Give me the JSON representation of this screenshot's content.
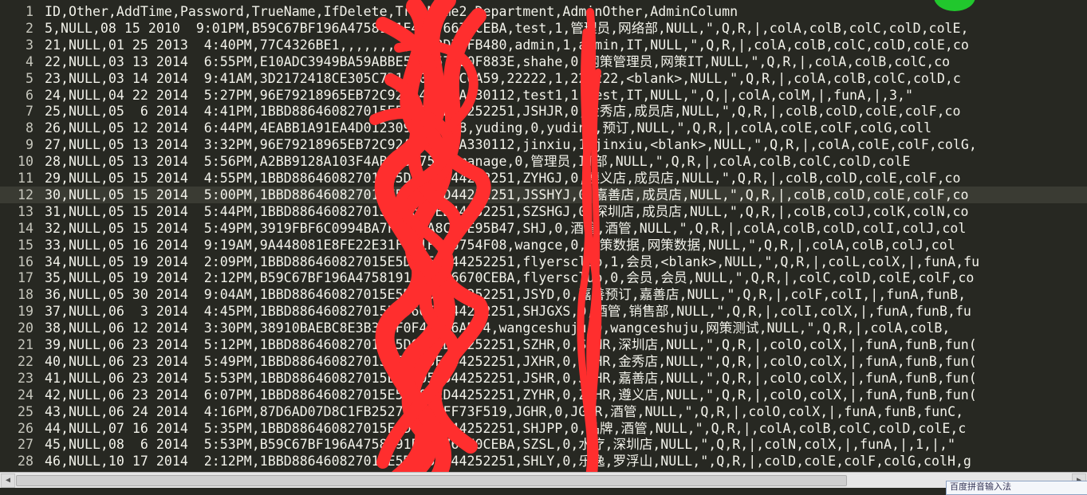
{
  "editor": {
    "lines": [
      {
        "num": "1",
        "text": "ID,Other,AddTime,Password,TrueName,IfDelete,TrueName2,Department,AdminOther,AdminColumn"
      },
      {
        "num": "2",
        "text": "5,NULL,08 15 2010  9:01PM,B59C67BF196A4758191E42F76670CEBA,test,1,管理员,网络部,NULL,\",Q,R,|,colA,colB,colC,colD,colE,"
      },
      {
        "num": "3",
        "text": "21,NULL,01 25 2013  4:40PM,77C4326BE1,,,,,,,,,,CF3D7BFB480,admin,1,admin,IT,NULL,\",Q,R,|,colA,colB,colC,colD,colE,co"
      },
      {
        "num": "4",
        "text": "22,NULL,03 13 2014  6:55PM,E10ADC3949BA59ABBE56E057F20F883E,shahe,0,网策管理员,网策IT,NULL,\",Q,R,|,colA,colB,colC,co"
      },
      {
        "num": "5",
        "text": "23,NULL,03 14 2014  9:41AM,3D2172418CE305C7D16D05597C6A59,22222,1,222222,<blank>,NULL,\",Q,R,|,colA,colB,colC,colD,c"
      },
      {
        "num": "6",
        "text": "24,NULL,04 22 2014  5:27PM,96E79218965EB72C92A549DD5A330112,test1,1,test,IT,NULL,\",Q,|,colA,colM,|,funA,|,3,\""
      },
      {
        "num": "7",
        "text": "25,NULL,05  6 2014  4:41PM,1BBD886460827015E5D605ED44252251,JSHJR,0,金秀店,成员店,NULL,\",Q,R,|,colB,colD,colE,colF,co"
      },
      {
        "num": "8",
        "text": "26,NULL,05 12 2014  6:44PM,4EABB1A91EA4D0123093BC69E8,yuding,0,yuding,预订,NULL,\",Q,R,|,colA,colE,colF,colG,coll"
      },
      {
        "num": "9",
        "text": "27,NULL,05 13 2014  3:32PM,96E79218965EB72C92A549DD5A330112,jinxiu,1,jinxiu,<blank>,NULL,\",Q,R,|,colA,colE,colF,colG,"
      },
      {
        "num": "10",
        "text": "28,NULL,05 13 2014  5:56PM,A2BB9128A103F4ABE65B759A,manage,0,管理员,IT部,NULL,\",Q,R,|,colA,colB,colC,colD,colE"
      },
      {
        "num": "11",
        "text": "29,NULL,05 15 2014  4:55PM,1BBD886460827015E5D605ED44252251,ZYHGJ,0,遵义店,成员店,NULL,\",Q,R,|,colB,colD,colE,colF,co"
      },
      {
        "num": "12",
        "text": "30,NULL,05 15 2014  5:00PM,1BBD886460827015E5D605ED44252251,JSSHYJ,0,嘉善店,成员店,NULL,\",Q,R,|,colB,colD,colE,colF,co"
      },
      {
        "num": "13",
        "text": "31,NULL,05 15 2014  5:44PM,1BBD886460827015E5D605ED44252251,SZSHGJ,0,深圳店,成员店,NULL,\",Q,R,|,colB,colJ,colK,colN,co"
      },
      {
        "num": "14",
        "text": "32,NULL,05 15 2014  5:49PM,3919FBF6C0994BA7F5C8BA8C30E95B47,SHJ,0,酒管,酒管,NULL,\",Q,R,|,colA,colB,colD,colI,colJ,col"
      },
      {
        "num": "15",
        "text": "33,NULL,05 16 2014  9:19AM,9A448081E8FE22E31FDC1F326754F08,wangce,0,网策数据,网策数据,NULL,\",Q,R,|,colA,colB,colJ,col"
      },
      {
        "num": "16",
        "text": "34,NULL,05 19 2014  2:09PM,1BBD886460827015E5D605ED44252251,flyersclub,1,会员,<blank>,NULL,\",Q,R,|,colL,colX,|,funA,fu"
      },
      {
        "num": "17",
        "text": "35,NULL,05 19 2014  2:12PM,B59C67BF196A4758191E42F76670CEBA,flyersclub,0,会员,会员,NULL,\",Q,R,|,colC,colD,colE,colF,co"
      },
      {
        "num": "18",
        "text": "36,NULL,05 30 2014  9:04AM,1BBD886460827015E5D605ED44252251,JSYD,0,嘉善预订,嘉善店,NULL,\",Q,R,|,colF,colI,|,funA,funB,"
      },
      {
        "num": "19",
        "text": "37,NULL,06  3 2014  4:45PM,1BBD886460827015E5D605ED44252251,SHJGXS,0,酒管,销售部,NULL,\",Q,R,|,colI,colX,|,funA,funB,fu"
      },
      {
        "num": "20",
        "text": "38,NULL,06 12 2014  3:30PM,38910BAEBC8E3B3D0F0F4B8A6AB54,wangceshuju,0,wangceshuju,网策测试,NULL,\",Q,R,|,colA,colB,"
      },
      {
        "num": "21",
        "text": "39,NULL,06 23 2014  5:12PM,1BBD886460827015E5D605ED44252251,SZHR,0,SZHR,深圳店,NULL,\",Q,R,|,colO,colX,|,funA,funB,fun("
      },
      {
        "num": "22",
        "text": "40,NULL,06 23 2014  5:49PM,1BBD886460827015E5D605ED44252251,JXHR,0,JXHR,金秀店,NULL,\",Q,R,|,colO,colX,|,funA,funB,fun("
      },
      {
        "num": "23",
        "text": "41,NULL,06 23 2014  5:53PM,1BBD886460827015E5D605ED44252251,JSHR,0,JSHR,嘉善店,NULL,\",Q,R,|,colO,colX,|,funA,funB,fun("
      },
      {
        "num": "24",
        "text": "42,NULL,06 23 2014  6:07PM,1BBD886460827015E5D605ED44252251,ZYHR,0,ZYHR,遵义店,NULL,\",Q,R,|,colO,colX,|,funA,funB,fun("
      },
      {
        "num": "25",
        "text": "43,NULL,06 24 2014  4:16PM,87D6AD07D8C1FB2527EA39EFF73F519,JGHR,0,JGHR,酒管,NULL,\",Q,R,|,colO,colX,|,funA,funB,funC,"
      },
      {
        "num": "26",
        "text": "44,NULL,07 16 2014  5:35PM,1BBD886460827015E5D605ED44252251,SHJPP,0,品牌,酒管,NULL,\",Q,R,|,colA,colB,colC,colD,colE,c"
      },
      {
        "num": "27",
        "text": "45,NULL,08  6 2014  5:53PM,B59C67BF196A4758191E42F76670CEBA,SZSL,0,水疗,深圳店,NULL,\",Q,R,|,colN,colX,|,funA,|,1,|,\""
      },
      {
        "num": "28",
        "text": "46,NULL,10 17 2014  2:12PM,1BBD886460827015E5D605ED44252251,SHLY,0,乐逸,罗浮山,NULL,\",Q,R,|,colD,colE,colF,colG,colH,g"
      }
    ],
    "current_line": "12"
  },
  "colors": {
    "background": "#272822",
    "text": "#f2f2ea",
    "gutter_text": "#c8c8be",
    "current_line": "#3a3b33",
    "scribble": "#ff2e2e",
    "indicator": "#21c72d"
  },
  "statusbar": {
    "badge_text": "百度拼音输入法"
  }
}
